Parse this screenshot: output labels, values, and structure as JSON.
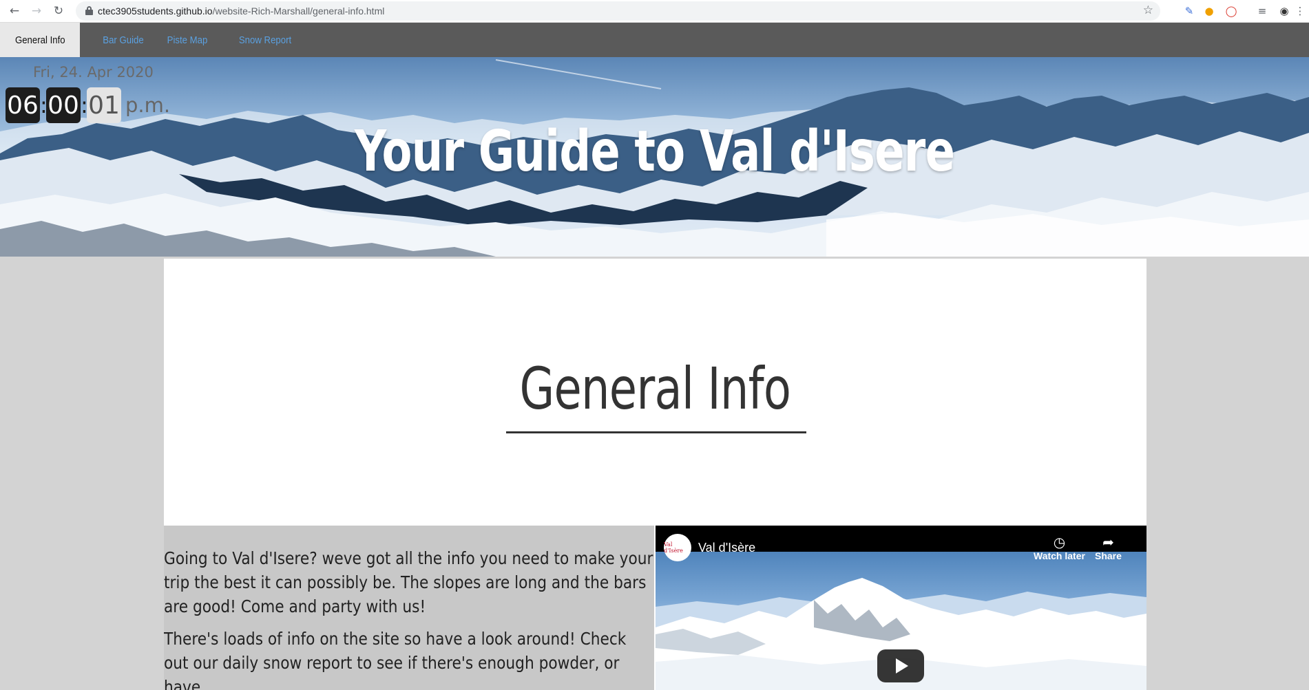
{
  "browser": {
    "url_host": "ctec3905students.github.io",
    "url_path": "/website-Rich-Marshall/general-info.html"
  },
  "nav": {
    "items": [
      {
        "label": "General Info",
        "active": true
      },
      {
        "label": "Bar Guide",
        "active": false
      },
      {
        "label": "Piste Map",
        "active": false
      },
      {
        "label": "Snow Report",
        "active": false
      }
    ]
  },
  "hero": {
    "date": "Fri, 24. Apr 2020",
    "clock": {
      "hours": "06",
      "minutes": "00",
      "seconds": "01",
      "separator": ":",
      "ampm": "p.m."
    },
    "title": "Your Guide to Val d'Isere"
  },
  "main": {
    "heading": "General Info",
    "paragraphs": [
      "Going to Val d'Isere? weve got all the info you need to make your trip the best it can possibly be. The slopes are long and the bars are good! Come and party with us!",
      "There's loads of info on the site so have a look around! Check out our daily snow report to see if there's enough powder, or have"
    ]
  },
  "video": {
    "title": "Val d'Isère",
    "channel_logo_text": "Val d'Isère",
    "watch_later_label": "Watch later",
    "share_label": "Share"
  },
  "colors": {
    "nav_bg": "#5a5a5a",
    "nav_link": "#5aa0e0",
    "page_bg": "#d3d3d3",
    "text_col_bg": "#c8c8c8"
  }
}
